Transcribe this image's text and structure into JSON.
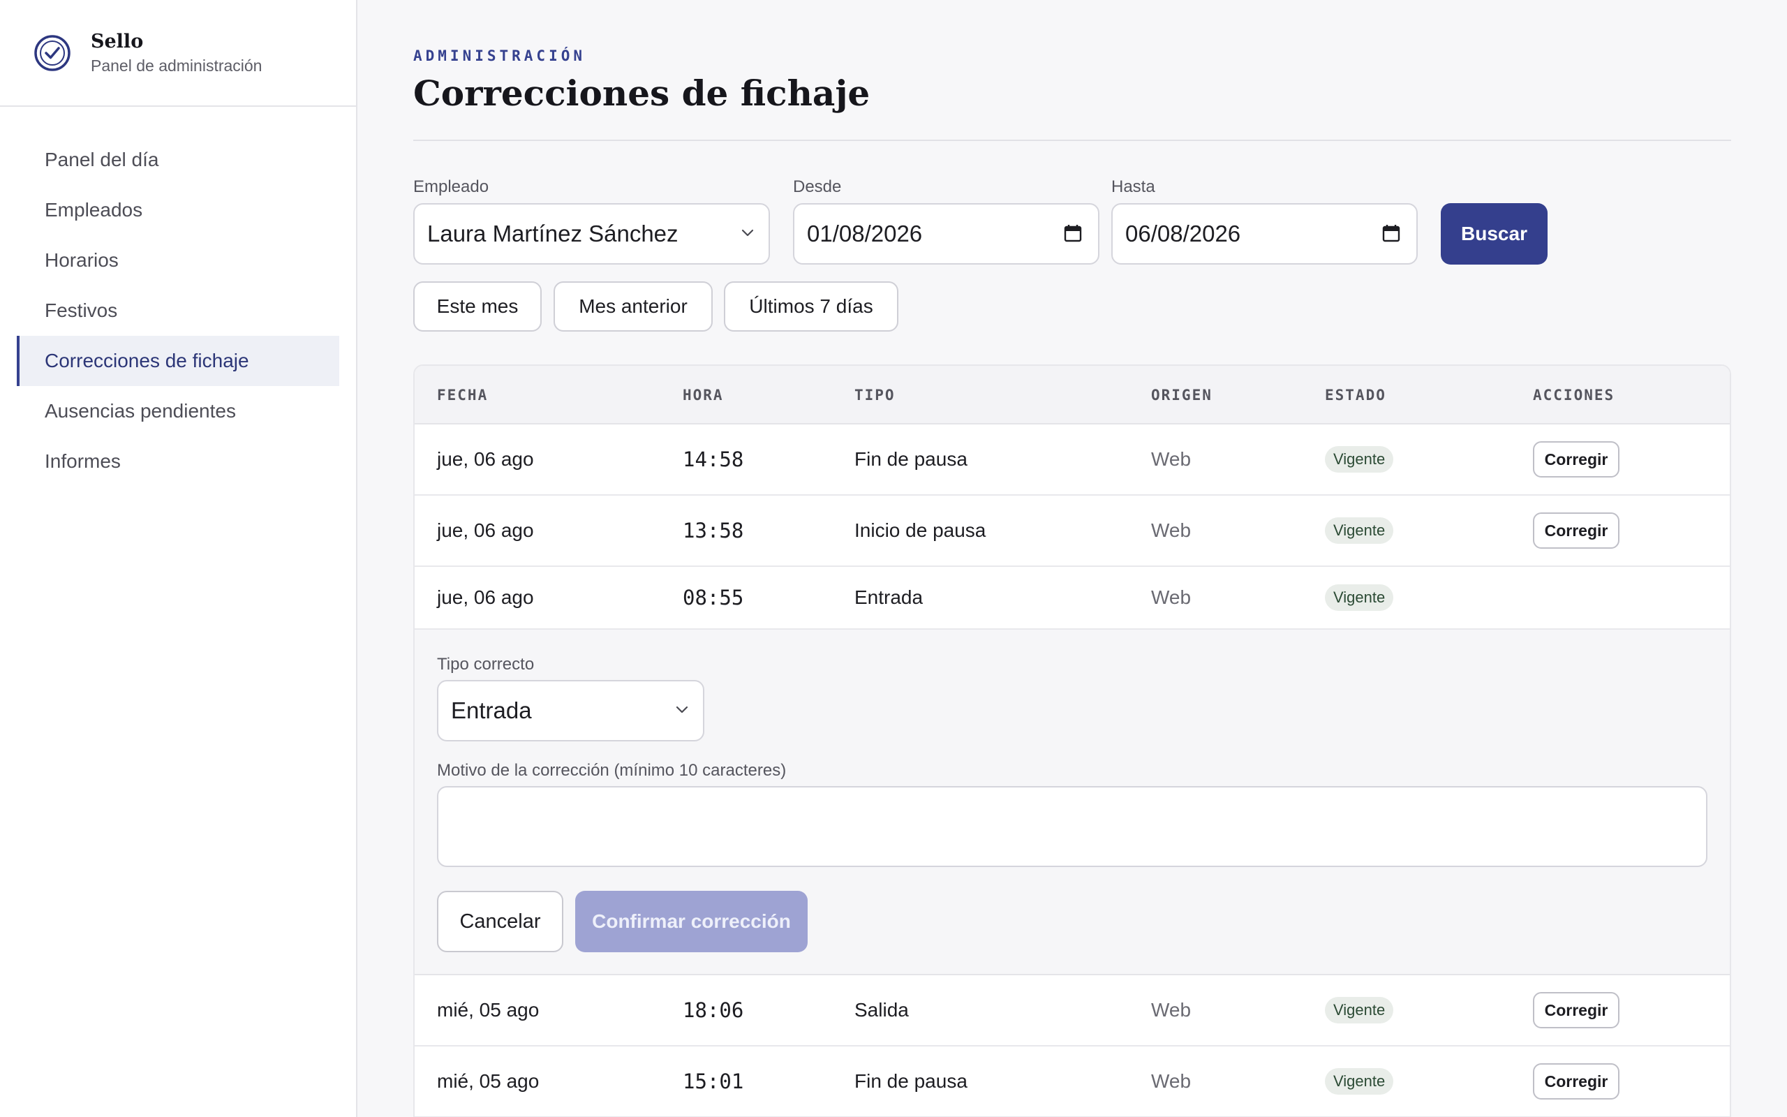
{
  "brand": {
    "name": "Sello",
    "subtitle": "Panel de administración"
  },
  "sidebar": {
    "items": [
      {
        "label": "Panel del día",
        "active": false
      },
      {
        "label": "Empleados",
        "active": false
      },
      {
        "label": "Horarios",
        "active": false
      },
      {
        "label": "Festivos",
        "active": false
      },
      {
        "label": "Correcciones de fichaje",
        "active": true
      },
      {
        "label": "Ausencias pendientes",
        "active": false
      },
      {
        "label": "Informes",
        "active": false
      }
    ]
  },
  "header": {
    "eyebrow": "ADMINISTRACIÓN",
    "title": "Correcciones de fichaje"
  },
  "filters": {
    "employee_label": "Empleado",
    "employee_value": "Laura Martínez Sánchez",
    "from_label": "Desde",
    "from_value": "01/08/2026",
    "to_label": "Hasta",
    "to_value": "06/08/2026",
    "search_button": "Buscar",
    "quick_ranges": [
      "Este mes",
      "Mes anterior",
      "Últimos 7 días"
    ]
  },
  "table": {
    "columns": [
      "FECHA",
      "HORA",
      "TIPO",
      "ORIGEN",
      "ESTADO",
      "ACCIONES"
    ],
    "action_label": "Corregir",
    "rows": [
      {
        "fecha": "jue, 06 ago",
        "hora": "14:58",
        "tipo": "Fin de pausa",
        "origen": "Web",
        "estado": "Vigente"
      },
      {
        "fecha": "jue, 06 ago",
        "hora": "13:58",
        "tipo": "Inicio de pausa",
        "origen": "Web",
        "estado": "Vigente"
      },
      {
        "fecha": "jue, 06 ago",
        "hora": "08:55",
        "tipo": "Entrada",
        "origen": "Web",
        "estado": "Vigente"
      },
      {
        "fecha": "mié, 05 ago",
        "hora": "18:06",
        "tipo": "Salida",
        "origen": "Web",
        "estado": "Vigente"
      },
      {
        "fecha": "mié, 05 ago",
        "hora": "15:01",
        "tipo": "Fin de pausa",
        "origen": "Web",
        "estado": "Vigente"
      }
    ]
  },
  "correction": {
    "type_label": "Tipo correcto",
    "type_value": "Entrada",
    "reason_label": "Motivo de la corrección (mínimo 10 caracteres)",
    "reason_value": "",
    "cancel_button": "Cancelar",
    "confirm_button": "Confirmar corrección"
  },
  "colors": {
    "accent": "#343f8d",
    "accent_disabled": "#9ea3d3",
    "badge_bg": "#e9ede9",
    "active_nav_bg": "#eef0f6"
  }
}
